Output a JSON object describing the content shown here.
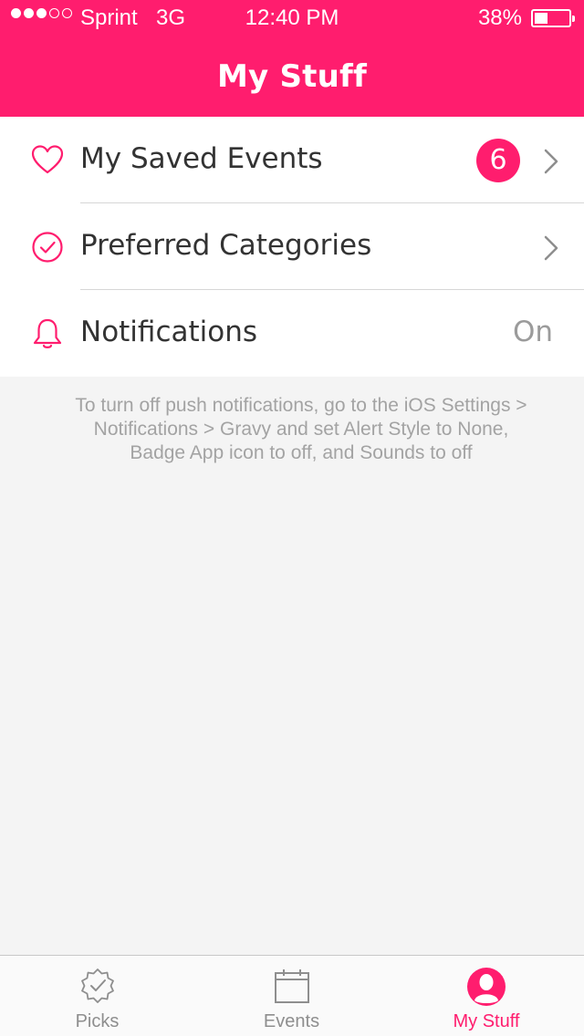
{
  "status_bar": {
    "signal_filled": 3,
    "signal_total": 5,
    "carrier": "Sprint",
    "network": "3G",
    "time": "12:40 PM",
    "battery_percent_label": "38%",
    "battery_level": 0.38
  },
  "header": {
    "title": "My Stuff",
    "background_color": "#ff1d6e"
  },
  "menu": {
    "items": [
      {
        "label": "My Saved Events",
        "icon": "heart-icon",
        "badge": "6",
        "accessory": "chevron-right-icon"
      },
      {
        "label": "Preferred Categories",
        "icon": "check-circle-icon",
        "accessory": "chevron-right-icon"
      },
      {
        "label": "Notifications",
        "icon": "bell-icon",
        "value": "On"
      }
    ]
  },
  "info_text": "To turn off push notifications, go to the iOS Settings > Notifications > Gravy and set Alert Style to None, Badge App icon to off, and Sounds to off",
  "tabbar": {
    "tabs": [
      {
        "label": "Picks",
        "icon": "badge-check-icon",
        "active": false
      },
      {
        "label": "Events",
        "icon": "calendar-icon",
        "active": false
      },
      {
        "label": "My Stuff",
        "icon": "user-circle-icon",
        "active": true
      }
    ]
  },
  "colors": {
    "accent": "#ff1d6e",
    "muted_text": "#a3a3a3",
    "background": "#f4f4f4"
  }
}
